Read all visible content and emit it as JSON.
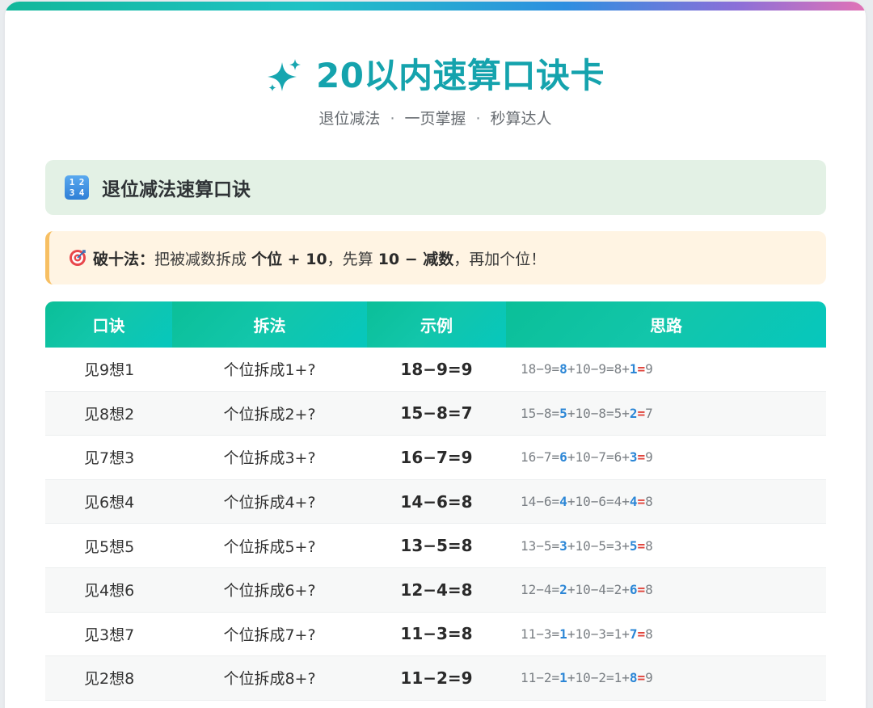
{
  "header": {
    "title": "20以内速算口诀卡",
    "subtitle_parts": [
      "退位减法",
      "一页掌握",
      "秒算达人"
    ],
    "subtitle_separator": "·"
  },
  "section": {
    "title": "退位减法速算口诀",
    "icon_digits": [
      "1",
      "2",
      "3",
      "4"
    ]
  },
  "tip": {
    "label": "破十法：",
    "text1": "把被减数拆成 ",
    "bold1": "个位 + 10",
    "text2": "，先算 ",
    "bold2": "10 − 减数",
    "text3": "，再加个位！"
  },
  "table": {
    "headers": [
      "口诀",
      "拆法",
      "示例",
      "思路"
    ],
    "rows": [
      {
        "rhyme": "见9想1",
        "split": "个位拆成1+?",
        "example": "18−9=9",
        "p1": "18−9=",
        "a": "8",
        "p2": "+10−9=8+",
        "b": "1",
        "eq": "=",
        "r": "9"
      },
      {
        "rhyme": "见8想2",
        "split": "个位拆成2+?",
        "example": "15−8=7",
        "p1": "15−8=",
        "a": "5",
        "p2": "+10−8=5+",
        "b": "2",
        "eq": "=",
        "r": "7"
      },
      {
        "rhyme": "见7想3",
        "split": "个位拆成3+?",
        "example": "16−7=9",
        "p1": "16−7=",
        "a": "6",
        "p2": "+10−7=6+",
        "b": "3",
        "eq": "=",
        "r": "9"
      },
      {
        "rhyme": "见6想4",
        "split": "个位拆成4+?",
        "example": "14−6=8",
        "p1": "14−6=",
        "a": "4",
        "p2": "+10−6=4+",
        "b": "4",
        "eq": "=",
        "r": "8"
      },
      {
        "rhyme": "见5想5",
        "split": "个位拆成5+?",
        "example": "13−5=8",
        "p1": "13−5=",
        "a": "3",
        "p2": "+10−5=3+",
        "b": "5",
        "eq": "=",
        "r": "8"
      },
      {
        "rhyme": "见4想6",
        "split": "个位拆成6+?",
        "example": "12−4=8",
        "p1": "12−4=",
        "a": "2",
        "p2": "+10−4=2+",
        "b": "6",
        "eq": "=",
        "r": "8"
      },
      {
        "rhyme": "见3想7",
        "split": "个位拆成7+?",
        "example": "11−3=8",
        "p1": "11−3=",
        "a": "1",
        "p2": "+10−3=1+",
        "b": "7",
        "eq": "=",
        "r": "8"
      },
      {
        "rhyme": "见2想8",
        "split": "个位拆成8+?",
        "example": "11−2=9",
        "p1": "11−2=",
        "a": "1",
        "p2": "+10−2=1+",
        "b": "8",
        "eq": "=",
        "r": "9"
      }
    ]
  },
  "colors": {
    "title": "#15a3ad",
    "table_header": "#0bbf98",
    "highlight_blue": "#2b86d6",
    "highlight_red": "#e0443c",
    "tip_border": "#f7bf62",
    "section_bg": "#e3f1e5"
  },
  "icons": {
    "title": "sparkles-icon",
    "section": "input-numbers-icon",
    "tip": "target-icon"
  }
}
